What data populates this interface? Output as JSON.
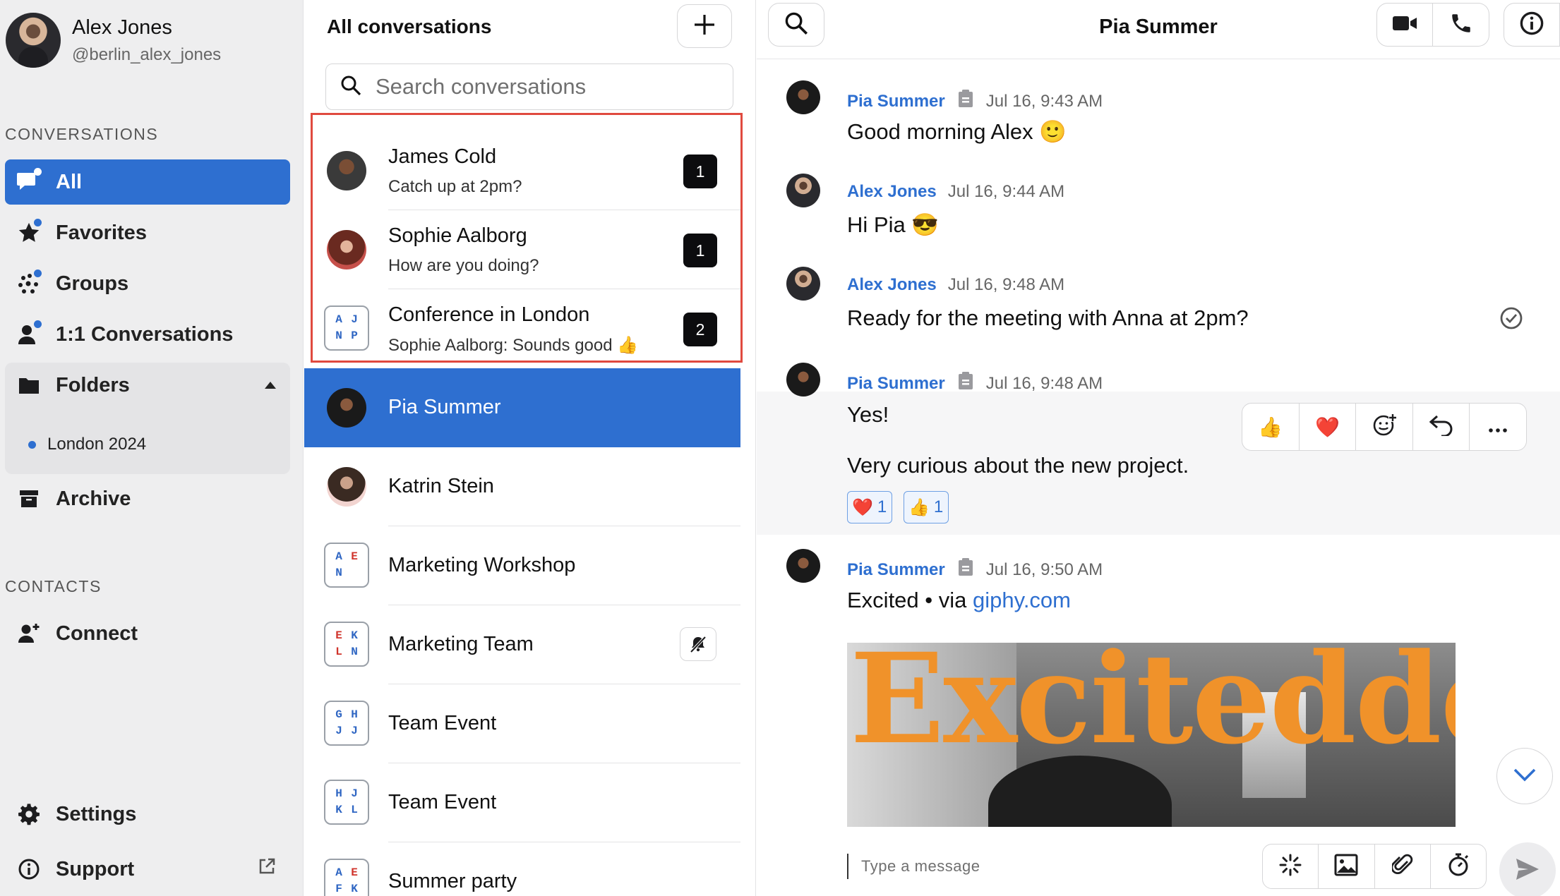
{
  "profile": {
    "name": "Alex Jones",
    "handle": "@berlin_alex_jones"
  },
  "sidebar": {
    "conversations_heading": "CONVERSATIONS",
    "items": [
      {
        "label": "All",
        "icon": "chat-bubbles-icon"
      },
      {
        "label": "Favorites",
        "icon": "star-icon"
      },
      {
        "label": "Groups",
        "icon": "groups-dots-icon"
      },
      {
        "label": "1:1 Conversations",
        "icon": "person-icon"
      },
      {
        "label": "Folders",
        "icon": "folder-icon"
      },
      {
        "label": "Archive",
        "icon": "archive-icon"
      }
    ],
    "folder_items": [
      {
        "label": "London 2024"
      }
    ],
    "contacts_heading": "CONTACTS",
    "connect_label": "Connect",
    "settings_label": "Settings",
    "support_label": "Support"
  },
  "list": {
    "title": "All conversations",
    "search_placeholder": "Search conversations",
    "conversations": [
      {
        "name": "James Cold",
        "preview": "Catch up at 2pm?",
        "unread": "1"
      },
      {
        "name": "Sophie Aalborg",
        "preview": "How are you doing?",
        "unread": "1"
      },
      {
        "name": "Conference in London",
        "preview": "Sophie Aalborg: Sounds good 👍",
        "unread": "2",
        "initials": [
          "A",
          "J",
          "N",
          "P"
        ]
      },
      {
        "name": "Pia Summer"
      },
      {
        "name": "Katrin Stein"
      },
      {
        "name": "Marketing Workshop",
        "initials": [
          "A",
          "E",
          "N",
          ""
        ]
      },
      {
        "name": "Marketing Team",
        "initials": [
          "E",
          "K",
          "L",
          "N"
        ]
      },
      {
        "name": "Team Event",
        "initials": [
          "G",
          "H",
          "J",
          "J"
        ]
      },
      {
        "name": "Team Event",
        "initials": [
          "H",
          "J",
          "K",
          "L"
        ]
      },
      {
        "name": "Summer party",
        "initials": [
          "A",
          "E",
          "F",
          "K"
        ]
      }
    ]
  },
  "chat": {
    "title": "Pia Summer",
    "messages": [
      {
        "author": "Pia Summer",
        "time": "Jul 16, 9:43 AM",
        "text": "Good morning Alex 🙂"
      },
      {
        "author": "Alex Jones",
        "time": "Jul 16, 9:44 AM",
        "text": "Hi Pia 😎"
      },
      {
        "author": "Alex Jones",
        "time": "Jul 16, 9:48 AM",
        "text": "Ready for the meeting with Anna at 2pm?"
      },
      {
        "author": "Pia Summer",
        "time": "Jul 16, 9:48 AM",
        "text": "Yes!"
      },
      {
        "text": "Very curious about the new project."
      },
      {
        "author": "Pia Summer",
        "time": "Jul 16, 9:50 AM",
        "text": "Excited",
        "via": "• via",
        "link": "giphy.com"
      }
    ],
    "reactions": [
      {
        "emoji": "❤️",
        "count": "1"
      },
      {
        "emoji": "👍",
        "count": "1"
      }
    ],
    "toolbar": {
      "thumbs": "👍",
      "heart": "❤️"
    },
    "gif_text": "Excitedddd",
    "composer_placeholder": "Type a message"
  },
  "colors": {
    "accent": "#2e6fd0",
    "highlight": "#e04a3f",
    "badge": "#0c0c0e",
    "gif_text": "#f0922a"
  }
}
